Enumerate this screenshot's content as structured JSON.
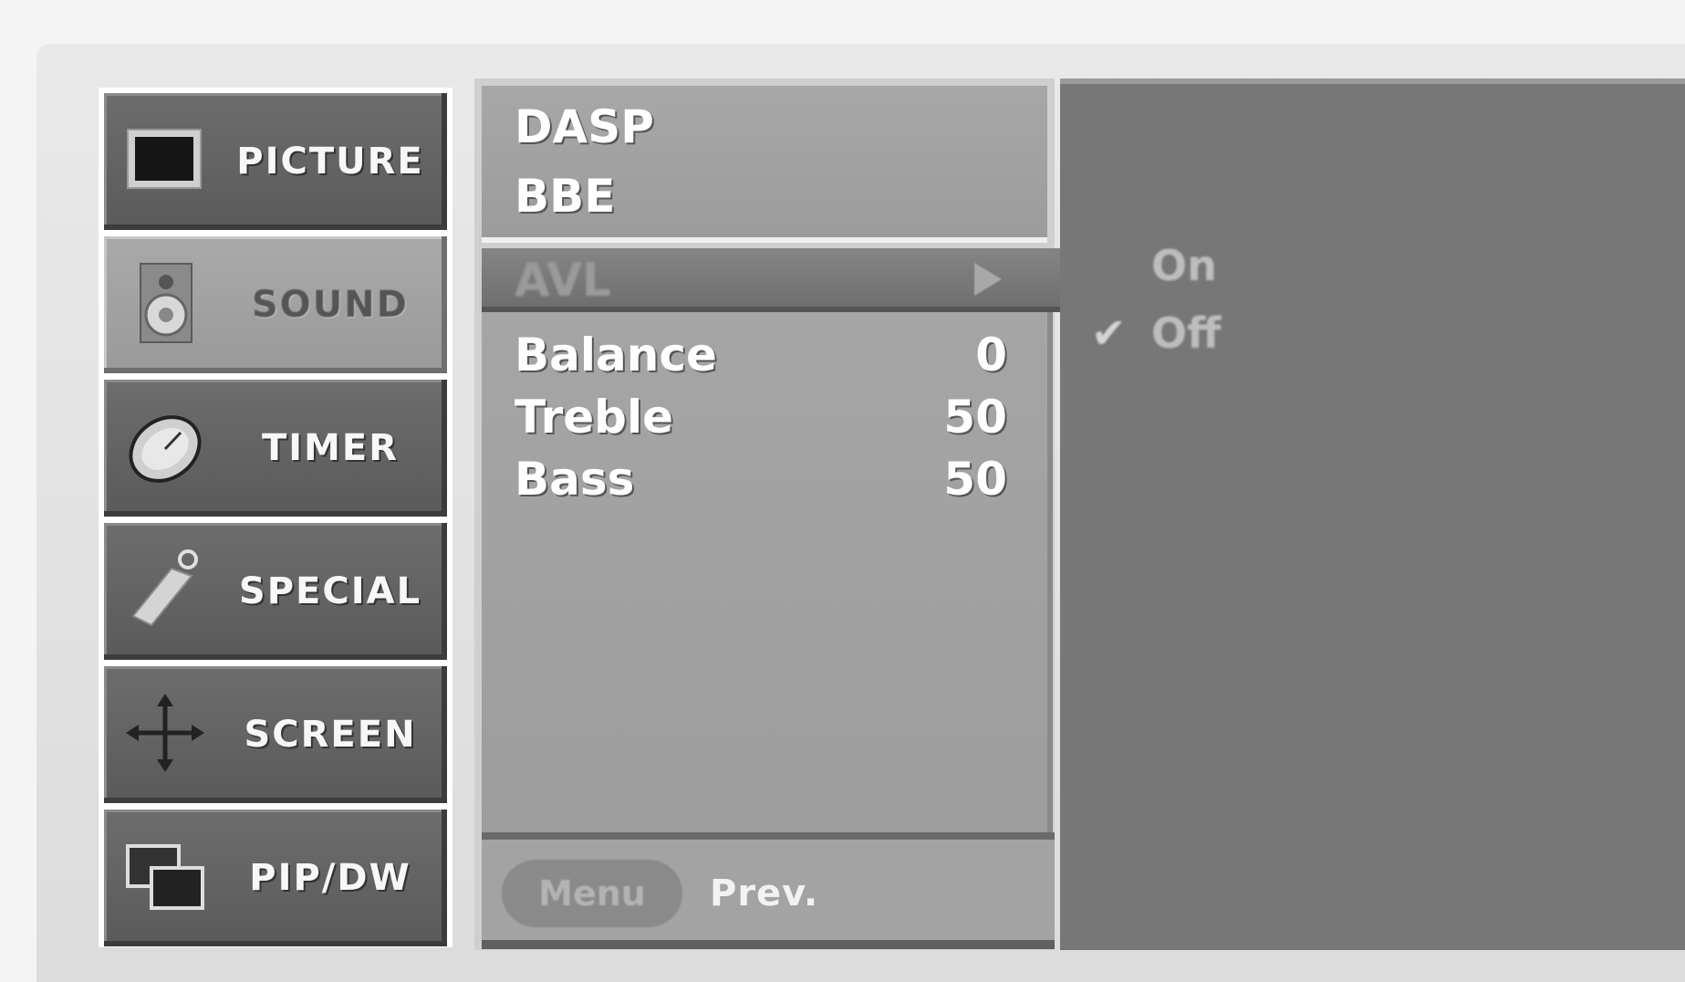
{
  "menu": {
    "items": [
      {
        "label": "PICTURE",
        "icon": "monitor-icon",
        "selected": false
      },
      {
        "label": "SOUND",
        "icon": "speaker-icon",
        "selected": true
      },
      {
        "label": "TIMER",
        "icon": "clock-icon",
        "selected": false
      },
      {
        "label": "SPECIAL",
        "icon": "tag-icon",
        "selected": false
      },
      {
        "label": "SCREEN",
        "icon": "move-arrows-icon",
        "selected": false
      },
      {
        "label": "PIP/DW",
        "icon": "pip-windows-icon",
        "selected": false
      }
    ]
  },
  "submenu": {
    "top_items": [
      "DASP",
      "BBE"
    ],
    "highlighted": {
      "label": "AVL"
    },
    "values": [
      {
        "label": "Balance",
        "value": "0"
      },
      {
        "label": "Treble",
        "value": "50"
      },
      {
        "label": "Bass",
        "value": "50"
      }
    ],
    "footer": {
      "button": "Menu",
      "hint": "Prev."
    }
  },
  "options": {
    "items": [
      {
        "label": "On",
        "checked": false
      },
      {
        "label": "Off",
        "checked": true
      }
    ],
    "check_glyph": "✔"
  }
}
